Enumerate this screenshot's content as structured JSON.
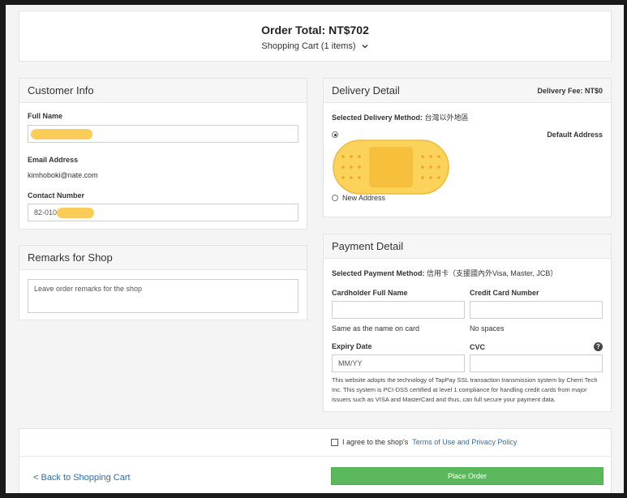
{
  "order": {
    "total_label": "Order Total: NT$702",
    "cart_label": "Shopping Cart (1 items)"
  },
  "customer": {
    "title": "Customer Info",
    "full_name_label": "Full Name",
    "email_label": "Email Address",
    "email_value": "kimhoboki@nate.com",
    "contact_label": "Contact Number",
    "contact_prefix": "82-010-"
  },
  "remarks": {
    "title": "Remarks for Shop",
    "placeholder": "Leave order remarks for the shop"
  },
  "delivery": {
    "title": "Delivery Detail",
    "fee": "Delivery Fee: NT$0",
    "method_label": "Selected Delivery Method:",
    "method_value": "台灣以外地區",
    "default_address": "Default Address",
    "new_address": "New Address"
  },
  "payment": {
    "title": "Payment Detail",
    "method_label": "Selected Payment Method:",
    "method_value": "信用卡（支援國內外Visa, Master, JCB）",
    "cardholder_label": "Cardholder Full Name",
    "card_number_label": "Credit Card Number",
    "cardholder_hint": "Same as the name on card",
    "card_number_hint": "No spaces",
    "expiry_label": "Expiry Date",
    "expiry_placeholder": "MM/YY",
    "cvc_label": "CVC",
    "help_glyph": "?",
    "disclaimer": "This website adopts the technology of TapPay SSL transaction transmission system by Cherri Tech Inc. This system is PCI-DSS certified at level 1 compliance for handling credit cards from major issuers such as VISA and MasterCard and thus, can full secure your payment data."
  },
  "footer": {
    "agree_prefix": "I agree to the shop's",
    "terms_link": "Terms of Use and Privacy Policy",
    "back_link": "< Back to Shopping Cart",
    "place_order": "Place Order"
  },
  "colors": {
    "accent_green": "#5cb85c",
    "link_blue": "#2d6ea8",
    "redaction": "#f9c847"
  }
}
